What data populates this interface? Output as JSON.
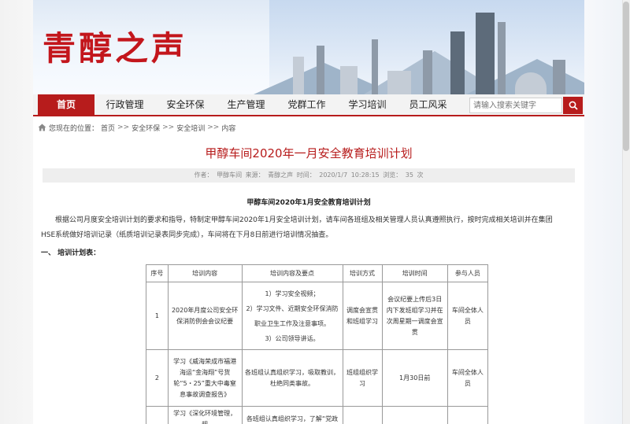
{
  "banner": {
    "title": "青醇之声"
  },
  "nav": {
    "items": [
      "首页",
      "行政管理",
      "安全环保",
      "生产管理",
      "党群工作",
      "学习培训",
      "员工风采"
    ],
    "active_index": 0,
    "search_placeholder": "请输入搜索关键字"
  },
  "breadcrumb": {
    "prefix": "您现在的位置：",
    "items": [
      "首页",
      "安全环保",
      "安全培训",
      "内容"
    ],
    "separator": ">>"
  },
  "article": {
    "title": "甲醇车间2020年一月安全教育培训计划",
    "meta": "作者： 甲醇车间    来源： 青醇之声    时间： 2020/1/7 10:28:15    浏览： 35 次",
    "subtitle": "甲醇车间2020年1月安全教育培训计划",
    "paragraph": "根据公司月度安全培训计划的要求和指导，特制定甲醇车间2020年1月安全培训计划，请车间各班组及相关管理人员认真遵照执行，按时完成相关培训并在集团HSE系统做好培训记录（纸质培训记录表同步完成），车间将在下月8日前进行培训情况抽查。",
    "section_heading": "一、 培训计划表："
  },
  "table": {
    "headers": [
      "序号",
      "培训内容",
      "培训内容及要点",
      "培训方式",
      "培训时间",
      "参与人员"
    ],
    "rows": [
      {
        "no": "1",
        "content": "2020年月度公司安全环保消防例会会议纪要",
        "points": [
          "1）学习安全视频；",
          "2）学习文件、近期安全环保消防职业卫生工作及注意事项。",
          "3）公司领导讲话。"
        ],
        "method": "调度会宣贯和班组学习",
        "time": "会议纪要上传后3日内下发班组学习并在次周星期一调度会宣贯",
        "people": "车间全体人员"
      },
      {
        "no": "2",
        "content": "学习《威海荣成市福港海运“金海翔”号货轮“5・25”重大中毒窒息事故调查报告》",
        "points": [
          "各班组认真组织学习，吸取教训，杜绝同类事故。"
        ],
        "method": "班组组织学习",
        "time": "1月30日前",
        "people": "车间全体人员"
      },
      {
        "no": "",
        "content": "学习《深化环境管理，规",
        "points": [
          "各班组认真组织学习，了解“党政"
        ],
        "method": "",
        "time": "",
        "people": ""
      }
    ]
  },
  "colors": {
    "brand_red": "#c3161c",
    "nav_active": "#b71c1c"
  }
}
